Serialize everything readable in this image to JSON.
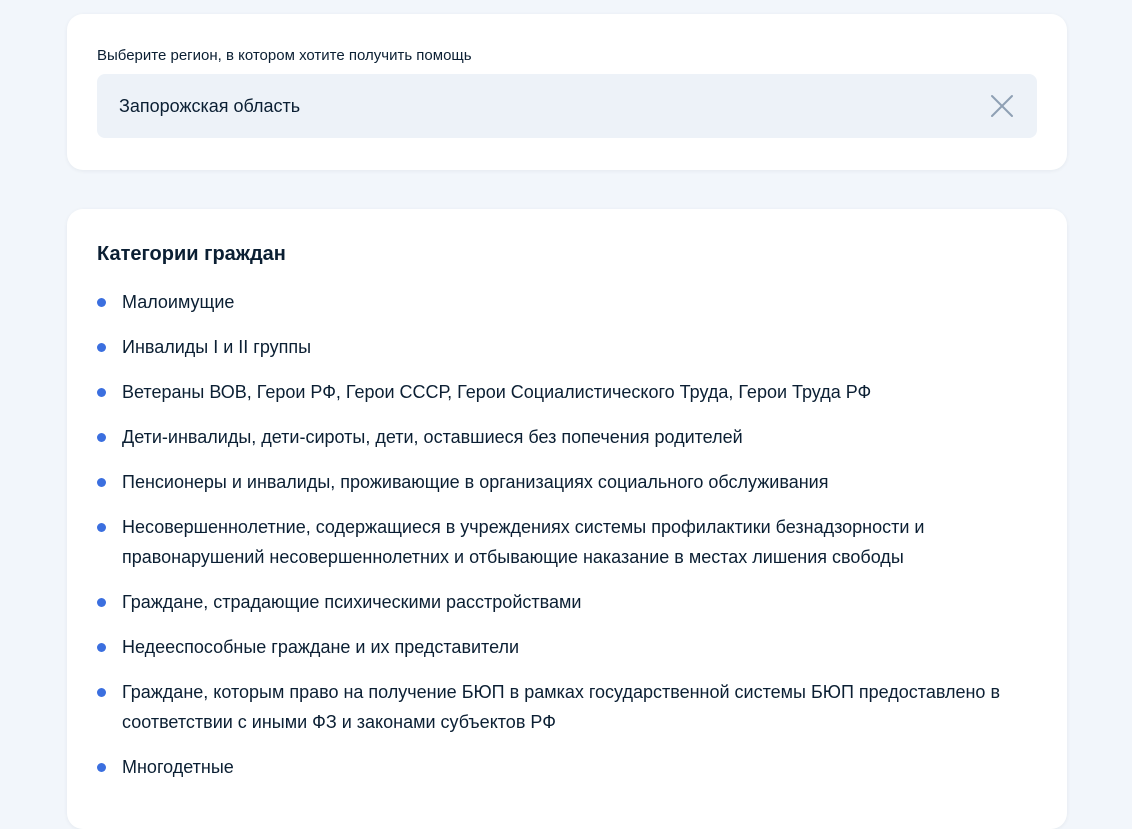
{
  "region": {
    "label": "Выберите регион, в котором хотите получить помощь",
    "value": "Запорожская область",
    "clear_icon": "close-icon"
  },
  "categories": {
    "title": "Категории граждан",
    "items": [
      "Малоимущие",
      "Инвалиды I и II группы",
      "Ветераны ВОВ, Герои РФ, Герои СССР, Герои Социалистического Труда, Герои Труда РФ",
      "Дети-инвалиды, дети-сироты, дети, оставшиеся без попечения родителей",
      "Пенсионеры и инвалиды, проживающие в организациях социального обслуживания",
      "Несовершеннолетние, содержащиеся в учреждениях системы профилактики безнадзорности и правонарушений несовершеннолетних и отбывающие наказание в местах лишения свободы",
      "Граждане, страдающие психическими расстройствами",
      "Недееспособные граждане и их представители",
      "Граждане, которым право на получение БЮП в рамках государственной системы БЮП предоставлено в соответствии с иными ФЗ и законами субъектов РФ",
      "Многодетные"
    ]
  },
  "colors": {
    "background": "#f2f6fb",
    "card": "#ffffff",
    "field": "#edf2f8",
    "text": "#0b1f33",
    "bullet": "#3b6fdf",
    "icon": "#8fa0b4"
  }
}
